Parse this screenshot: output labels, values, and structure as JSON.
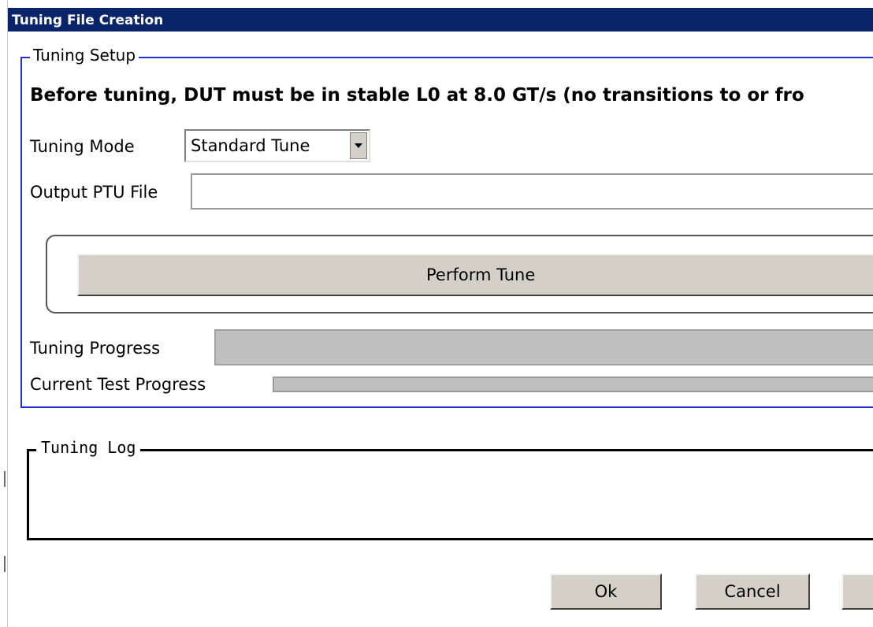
{
  "window": {
    "title": "Tuning File Creation"
  },
  "setup": {
    "legend": "Tuning Setup",
    "warning": "Before tuning, DUT must be in stable L0 at 8.0 GT/s (no transitions to or fro",
    "mode_label": "Tuning Mode",
    "mode_value": "Standard Tune",
    "output_label": "Output PTU File",
    "output_value": "",
    "tune_button": "Perform Tune",
    "tuning_progress_label": "Tuning Progress",
    "tuning_progress": 0,
    "current_progress_label": "Current Test Progress",
    "current_progress": 0
  },
  "log": {
    "legend": "Tuning Log"
  },
  "footer": {
    "ok": "Ok",
    "cancel": "Cancel"
  }
}
